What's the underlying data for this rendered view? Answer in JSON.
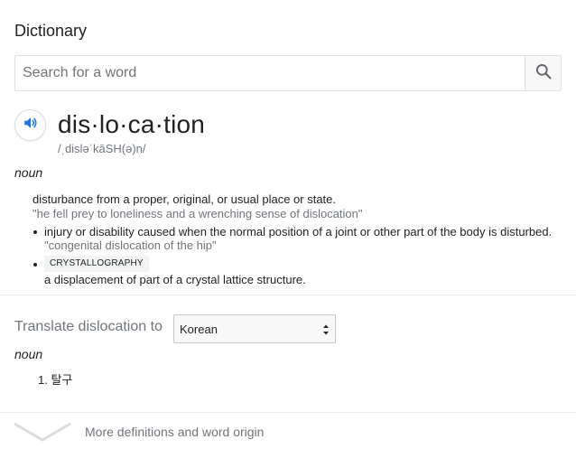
{
  "card": {
    "title": "Dictionary"
  },
  "search": {
    "placeholder": "Search for a word",
    "value": ""
  },
  "entry": {
    "headword": "dis·lo·ca·tion",
    "pronunciation": "/ˌdisləˈkāSH(ə)n/",
    "part_of_speech": "noun",
    "senses": [
      {
        "definition": "disturbance from a proper, original, or usual place or state.",
        "example": "\"he fell prey to loneliness and a wrenching sense of dislocation\""
      },
      {
        "definition": "injury or disability caused when the normal position of a joint or other part of the body is disturbed.",
        "example": "\"congenital dislocation of the hip\""
      },
      {
        "label": "CRYSTALLOGRAPHY",
        "definition": "a displacement of part of a crystal lattice structure."
      }
    ]
  },
  "translate": {
    "label": "Translate dislocation to",
    "selected_language": "Korean",
    "part_of_speech": "noun",
    "items": [
      "1. 탈구"
    ]
  },
  "footer": {
    "more_label": "More definitions and word origin"
  },
  "colors": {
    "accent_blue": "#1a73e8",
    "secondary_text": "#70757a",
    "divider": "#ebebeb"
  },
  "icons": {
    "search": "search-icon",
    "speaker": "speaker-icon",
    "select": "select-arrows-icon",
    "expand": "chevron-down-icon"
  }
}
